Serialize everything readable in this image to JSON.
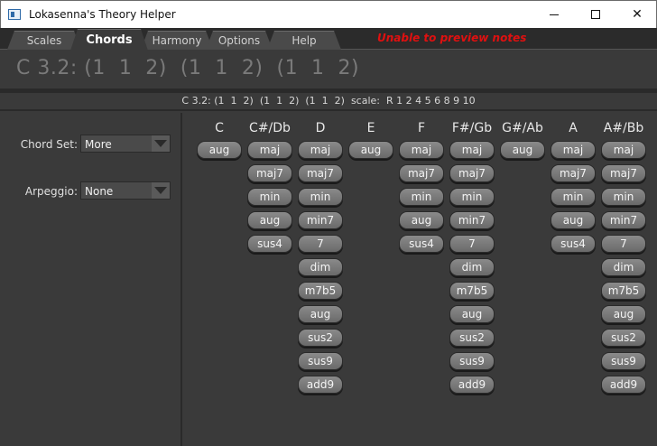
{
  "window": {
    "title": "Lokasenna's Theory Helper",
    "close_glyph": "✕"
  },
  "tabs": [
    {
      "label": "Scales"
    },
    {
      "label": "Chords"
    },
    {
      "label": "Harmony"
    },
    {
      "label": "Options"
    },
    {
      "label": "Help"
    }
  ],
  "active_tab": "Chords",
  "status_message": "Unable to preview notes",
  "status_color": "#e01010",
  "header": {
    "title": "C 3.2: (1  1  2)  (1  1  2)  (1  1  2)",
    "info": "C 3.2: (1  1  2)  (1  1  2)  (1  1  2)  scale:  R 1 2 4 5 6 8 9 10"
  },
  "controls": {
    "chord_set": {
      "label": "Chord Set:",
      "value": "More"
    },
    "arpeggio": {
      "label": "Arpeggio:",
      "value": "None"
    }
  },
  "chord_columns": [
    {
      "root": "C",
      "chords": [
        "aug"
      ]
    },
    {
      "root": "C#/Db",
      "chords": [
        "maj",
        "maj7",
        "min",
        "aug",
        "sus4"
      ]
    },
    {
      "root": "D",
      "chords": [
        "maj",
        "maj7",
        "min",
        "min7",
        "7",
        "dim",
        "m7b5",
        "aug",
        "sus2",
        "sus9",
        "add9"
      ]
    },
    {
      "root": "E",
      "chords": [
        "aug"
      ]
    },
    {
      "root": "F",
      "chords": [
        "maj",
        "maj7",
        "min",
        "aug",
        "sus4"
      ]
    },
    {
      "root": "F#/Gb",
      "chords": [
        "maj",
        "maj7",
        "min",
        "min7",
        "7",
        "dim",
        "m7b5",
        "aug",
        "sus2",
        "sus9",
        "add9"
      ]
    },
    {
      "root": "G#/Ab",
      "chords": [
        "aug"
      ]
    },
    {
      "root": "A",
      "chords": [
        "maj",
        "maj7",
        "min",
        "aug",
        "sus4"
      ]
    },
    {
      "root": "A#/Bb",
      "chords": [
        "maj",
        "maj7",
        "min",
        "min7",
        "7",
        "dim",
        "m7b5",
        "aug",
        "sus2",
        "sus9",
        "add9"
      ]
    }
  ]
}
